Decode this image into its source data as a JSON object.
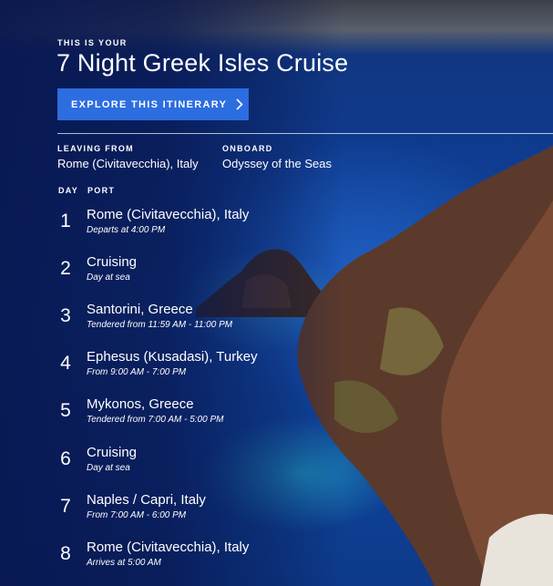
{
  "header": {
    "eyebrow": "THIS IS YOUR",
    "title": "7 Night Greek Isles Cruise",
    "cta_label": "EXPLORE THIS ITINERARY"
  },
  "meta": {
    "leaving_label": "LEAVING FROM",
    "leaving_value": "Rome (Civitavecchia), Italy",
    "onboard_label": "ONBOARD",
    "onboard_value": "Odyssey of the Seas"
  },
  "itinerary": {
    "day_header": "DAY",
    "port_header": "PORT",
    "rows": [
      {
        "day": "1",
        "port": "Rome (Civitavecchia), Italy",
        "note": "Departs at 4:00 PM"
      },
      {
        "day": "2",
        "port": "Cruising",
        "note": "Day at sea"
      },
      {
        "day": "3",
        "port": "Santorini, Greece",
        "note": "Tendered from 11:59 AM - 11:00 PM"
      },
      {
        "day": "4",
        "port": "Ephesus (Kusadasi), Turkey",
        "note": "From 9:00 AM - 7:00 PM"
      },
      {
        "day": "5",
        "port": "Mykonos, Greece",
        "note": "Tendered from 7:00 AM - 5:00 PM"
      },
      {
        "day": "6",
        "port": "Cruising",
        "note": "Day at sea"
      },
      {
        "day": "7",
        "port": "Naples / Capri, Italy",
        "note": "From 7:00 AM - 6:00 PM"
      },
      {
        "day": "8",
        "port": "Rome (Civitavecchia), Italy",
        "note": "Arrives at 5:00 AM"
      }
    ]
  },
  "colors": {
    "cta": "#2c6de0",
    "overlay": "#08164e"
  },
  "icons": {
    "cta_icon": "chevron-right-icon"
  }
}
